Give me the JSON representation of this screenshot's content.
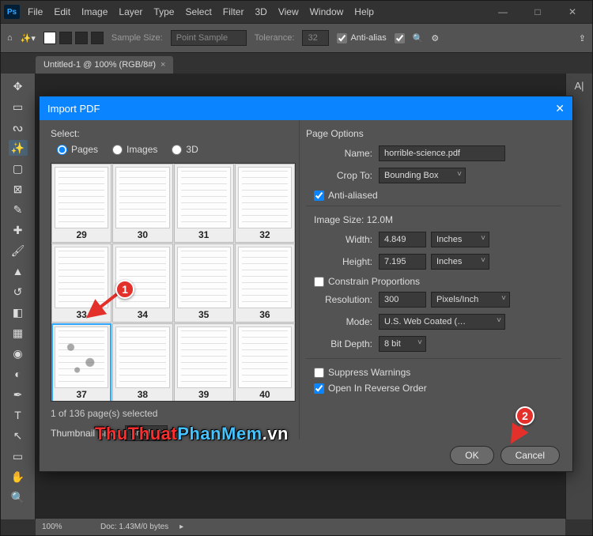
{
  "app": {
    "name": "Ps"
  },
  "menu": [
    "File",
    "Edit",
    "Image",
    "Layer",
    "Type",
    "Select",
    "Filter",
    "3D",
    "View",
    "Window",
    "Help"
  ],
  "options_bar": {
    "sample_size_label": "Sample Size:",
    "sample_size_value": "Point Sample",
    "tolerance_label": "Tolerance:",
    "tolerance_value": "32",
    "anti_alias_label": "Anti-alias"
  },
  "document_tab": {
    "title": "Untitled-1 @ 100% (RGB/8#)"
  },
  "status_bar": {
    "zoom": "100%",
    "doc_info": "Doc: 1.43M/0 bytes"
  },
  "dialog": {
    "title": "Import PDF",
    "select_label": "Select:",
    "radios": {
      "pages": "Pages",
      "images": "Images",
      "three_d": "3D"
    },
    "page_numbers": [
      29,
      30,
      31,
      32,
      33,
      34,
      35,
      36,
      37,
      38,
      39,
      40
    ],
    "selected_page": 37,
    "selection_info": "1 of 136 page(s) selected",
    "thumb_size_label": "Thumbnail Size:",
    "thumb_size_value": "Small",
    "page_options_label": "Page Options",
    "name_label": "Name:",
    "name_value": "horrible-science.pdf",
    "crop_to_label": "Crop To:",
    "crop_to_value": "Bounding Box",
    "anti_aliased_label": "Anti-aliased",
    "image_size_label": "Image Size: 12.0M",
    "width_label": "Width:",
    "width_value": "4.849",
    "width_unit": "Inches",
    "height_label": "Height:",
    "height_value": "7.195",
    "height_unit": "Inches",
    "constrain_label": "Constrain Proportions",
    "resolution_label": "Resolution:",
    "resolution_value": "300",
    "resolution_unit": "Pixels/Inch",
    "mode_label": "Mode:",
    "mode_value": "U.S. Web Coated (…",
    "bit_depth_label": "Bit Depth:",
    "bit_depth_value": "8 bit",
    "suppress_label": "Suppress Warnings",
    "reverse_label": "Open In Reverse Order",
    "ok": "OK",
    "cancel": "Cancel"
  },
  "annotations": {
    "marker1": "1",
    "marker2": "2"
  },
  "watermark": {
    "a": "ThuThuat",
    "b": "PhanMem",
    "c": ".vn"
  }
}
